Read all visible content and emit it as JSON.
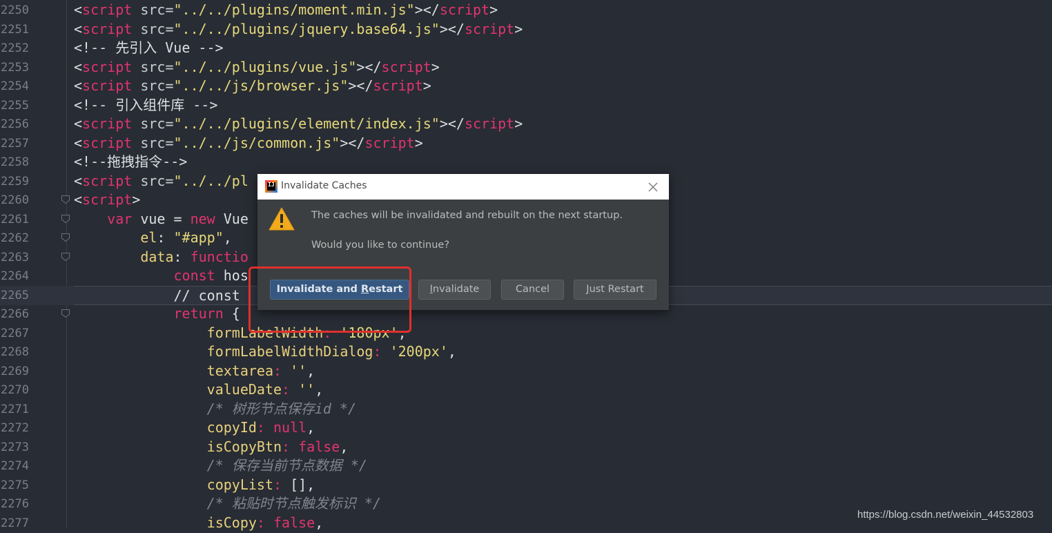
{
  "editor": {
    "lines": [
      {
        "num": "2250",
        "fold": false,
        "tokens": [
          {
            "t": "<",
            "c": "punct"
          },
          {
            "t": "script",
            "c": "tag"
          },
          {
            "t": " src=",
            "c": "attr"
          },
          {
            "t": "\"../../plugins/moment.min.js\"",
            "c": "str"
          },
          {
            "t": "></",
            "c": "punct"
          },
          {
            "t": "script",
            "c": "tag"
          },
          {
            "t": ">",
            "c": "punct"
          }
        ]
      },
      {
        "num": "2251",
        "fold": false,
        "tokens": [
          {
            "t": "<",
            "c": "punct"
          },
          {
            "t": "script",
            "c": "tag"
          },
          {
            "t": " src=",
            "c": "attr"
          },
          {
            "t": "\"../../plugins/jquery.base64.js\"",
            "c": "str"
          },
          {
            "t": "></",
            "c": "punct"
          },
          {
            "t": "script",
            "c": "tag"
          },
          {
            "t": ">",
            "c": "punct"
          }
        ]
      },
      {
        "num": "2252",
        "fold": false,
        "tokens": [
          {
            "t": "<!-- 先引入 Vue -->",
            "c": "plain"
          }
        ]
      },
      {
        "num": "2253",
        "fold": false,
        "tokens": [
          {
            "t": "<",
            "c": "punct"
          },
          {
            "t": "script",
            "c": "tag"
          },
          {
            "t": " src=",
            "c": "attr"
          },
          {
            "t": "\"../../plugins/vue.js\"",
            "c": "str"
          },
          {
            "t": "></",
            "c": "punct"
          },
          {
            "t": "script",
            "c": "tag"
          },
          {
            "t": ">",
            "c": "punct"
          }
        ]
      },
      {
        "num": "2254",
        "fold": false,
        "tokens": [
          {
            "t": "<",
            "c": "punct"
          },
          {
            "t": "script",
            "c": "tag"
          },
          {
            "t": " src=",
            "c": "attr"
          },
          {
            "t": "\"../../js/browser.js\"",
            "c": "str"
          },
          {
            "t": "></",
            "c": "punct"
          },
          {
            "t": "script",
            "c": "tag"
          },
          {
            "t": ">",
            "c": "punct"
          }
        ]
      },
      {
        "num": "2255",
        "fold": false,
        "tokens": [
          {
            "t": "<!-- 引入组件库 -->",
            "c": "plain"
          }
        ]
      },
      {
        "num": "2256",
        "fold": false,
        "tokens": [
          {
            "t": "<",
            "c": "punct"
          },
          {
            "t": "script",
            "c": "tag"
          },
          {
            "t": " src=",
            "c": "attr"
          },
          {
            "t": "\"../../plugins/element/index.js\"",
            "c": "str"
          },
          {
            "t": "></",
            "c": "punct"
          },
          {
            "t": "script",
            "c": "tag"
          },
          {
            "t": ">",
            "c": "punct"
          }
        ]
      },
      {
        "num": "2257",
        "fold": false,
        "tokens": [
          {
            "t": "<",
            "c": "punct"
          },
          {
            "t": "script",
            "c": "tag"
          },
          {
            "t": " src=",
            "c": "attr"
          },
          {
            "t": "\"../../js/common.js\"",
            "c": "str"
          },
          {
            "t": "></",
            "c": "punct"
          },
          {
            "t": "script",
            "c": "tag"
          },
          {
            "t": ">",
            "c": "punct"
          }
        ]
      },
      {
        "num": "2258",
        "fold": false,
        "tokens": [
          {
            "t": "<!--拖拽指令-->",
            "c": "plain"
          }
        ]
      },
      {
        "num": "2259",
        "fold": false,
        "tokens": [
          {
            "t": "<",
            "c": "punct"
          },
          {
            "t": "script",
            "c": "tag"
          },
          {
            "t": " src=",
            "c": "attr"
          },
          {
            "t": "\"../../pl",
            "c": "str"
          }
        ]
      },
      {
        "num": "2260",
        "fold": true,
        "tokens": [
          {
            "t": "<",
            "c": "punct"
          },
          {
            "t": "script",
            "c": "tag"
          },
          {
            "t": ">",
            "c": "punct"
          }
        ]
      },
      {
        "num": "2261",
        "fold": true,
        "tokens": [
          {
            "t": "    ",
            "c": "plain"
          },
          {
            "t": "var",
            "c": "key"
          },
          {
            "t": " vue = ",
            "c": "plain"
          },
          {
            "t": "new",
            "c": "key"
          },
          {
            "t": " Vue",
            "c": "plain"
          }
        ]
      },
      {
        "num": "2262",
        "fold": true,
        "tokens": [
          {
            "t": "        ",
            "c": "plain"
          },
          {
            "t": "el",
            "c": "prop"
          },
          {
            "t": ": ",
            "c": "plain"
          },
          {
            "t": "\"#app\"",
            "c": "str"
          },
          {
            "t": ",",
            "c": "plain"
          }
        ]
      },
      {
        "num": "2263",
        "fold": true,
        "tokens": [
          {
            "t": "        ",
            "c": "plain"
          },
          {
            "t": "data",
            "c": "prop"
          },
          {
            "t": ": ",
            "c": "plain"
          },
          {
            "t": "functio",
            "c": "key"
          }
        ]
      },
      {
        "num": "2264",
        "fold": false,
        "tokens": [
          {
            "t": "            ",
            "c": "plain"
          },
          {
            "t": "const",
            "c": "key"
          },
          {
            "t": " hos",
            "c": "plain"
          }
        ]
      },
      {
        "num": "2265",
        "fold": false,
        "current": true,
        "tokens": [
          {
            "t": "            // const",
            "c": "plain"
          }
        ]
      },
      {
        "num": "2266",
        "fold": true,
        "tokens": [
          {
            "t": "            ",
            "c": "plain"
          },
          {
            "t": "return",
            "c": "key"
          },
          {
            "t": " {",
            "c": "plain"
          }
        ]
      },
      {
        "num": "2267",
        "fold": false,
        "tokens": [
          {
            "t": "                ",
            "c": "plain"
          },
          {
            "t": "formLabelWidth",
            "c": "prop"
          },
          {
            "t": ": ",
            "c": "key"
          },
          {
            "t": "'180px'",
            "c": "str"
          },
          {
            "t": ",",
            "c": "plain"
          }
        ]
      },
      {
        "num": "2268",
        "fold": false,
        "tokens": [
          {
            "t": "                ",
            "c": "plain"
          },
          {
            "t": "formLabelWidthDialog",
            "c": "prop"
          },
          {
            "t": ": ",
            "c": "key"
          },
          {
            "t": "'200px'",
            "c": "str"
          },
          {
            "t": ",",
            "c": "plain"
          }
        ]
      },
      {
        "num": "2269",
        "fold": false,
        "tokens": [
          {
            "t": "                ",
            "c": "plain"
          },
          {
            "t": "textarea",
            "c": "prop"
          },
          {
            "t": ": ",
            "c": "key"
          },
          {
            "t": "''",
            "c": "str"
          },
          {
            "t": ",",
            "c": "plain"
          }
        ]
      },
      {
        "num": "2270",
        "fold": false,
        "tokens": [
          {
            "t": "                ",
            "c": "plain"
          },
          {
            "t": "valueDate",
            "c": "prop"
          },
          {
            "t": ": ",
            "c": "key"
          },
          {
            "t": "''",
            "c": "str"
          },
          {
            "t": ",",
            "c": "plain"
          }
        ]
      },
      {
        "num": "2271",
        "fold": false,
        "tokens": [
          {
            "t": "                ",
            "c": "plain"
          },
          {
            "t": "/* 树形节点保存id */",
            "c": "comment"
          }
        ]
      },
      {
        "num": "2272",
        "fold": false,
        "tokens": [
          {
            "t": "                ",
            "c": "plain"
          },
          {
            "t": "copyId",
            "c": "prop"
          },
          {
            "t": ": ",
            "c": "key"
          },
          {
            "t": "null",
            "c": "key"
          },
          {
            "t": ",",
            "c": "plain"
          }
        ]
      },
      {
        "num": "2273",
        "fold": false,
        "tokens": [
          {
            "t": "                ",
            "c": "plain"
          },
          {
            "t": "isCopyBtn",
            "c": "prop"
          },
          {
            "t": ": ",
            "c": "key"
          },
          {
            "t": "false",
            "c": "key"
          },
          {
            "t": ",",
            "c": "plain"
          }
        ]
      },
      {
        "num": "2274",
        "fold": false,
        "tokens": [
          {
            "t": "                ",
            "c": "plain"
          },
          {
            "t": "/* 保存当前节点数据 */",
            "c": "comment"
          }
        ]
      },
      {
        "num": "2275",
        "fold": false,
        "tokens": [
          {
            "t": "                ",
            "c": "plain"
          },
          {
            "t": "copyList",
            "c": "prop"
          },
          {
            "t": ": ",
            "c": "key"
          },
          {
            "t": "[],",
            "c": "plain"
          }
        ]
      },
      {
        "num": "2276",
        "fold": false,
        "tokens": [
          {
            "t": "                ",
            "c": "plain"
          },
          {
            "t": "/* 粘贴时节点触发标识 */",
            "c": "comment"
          }
        ]
      },
      {
        "num": "2277",
        "fold": false,
        "tokens": [
          {
            "t": "                ",
            "c": "plain"
          },
          {
            "t": "isCopy",
            "c": "prop"
          },
          {
            "t": ": ",
            "c": "key"
          },
          {
            "t": "false",
            "c": "key"
          },
          {
            "t": ",",
            "c": "plain"
          }
        ]
      }
    ]
  },
  "dialog": {
    "title": "Invalidate Caches",
    "message_line1": "The caches will be invalidated and rebuilt on the next startup.",
    "message_line2": "Would you like to continue?",
    "buttons": {
      "invalidate_restart": {
        "before": "Invalidate and ",
        "mnemonic": "R",
        "after": "estart"
      },
      "invalidate": {
        "before": "",
        "mnemonic": "I",
        "after": "nvalidate"
      },
      "cancel": "Cancel",
      "just_restart": {
        "before": "",
        "mnemonic": "J",
        "after": "ust Restart"
      }
    },
    "icons": {
      "app": "intellij-idea-icon",
      "warning": "warning-triangle-icon",
      "close": "close-icon"
    }
  },
  "annotation": {
    "highlight_color": "#e0302c"
  },
  "watermark": "https://blog.csdn.net/weixin_44532803",
  "colors": {
    "editor_bg": "#282c34",
    "keyword": "#e0356f",
    "string": "#e6d97a",
    "comment": "#7f848e",
    "primary_button": "#365880"
  }
}
